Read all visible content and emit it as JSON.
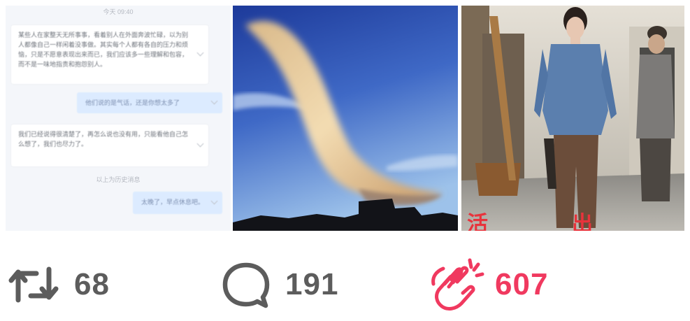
{
  "images": [
    {
      "label": "chat screenshot",
      "system_lines": [
        "今天 09:40",
        "以上为历史消息"
      ],
      "messages": [
        {
          "side": "in",
          "text": "某些人在家整天无所事事，看着别人在外面奔波忙碌，以为别人都像自己一样闲着没事做。其实每个人都有各自的压力和烦恼，只是不愿意表现出来而已，我们应该多一些理解和包容，而不是一味地指责和抱怨别人。"
        },
        {
          "side": "out",
          "text": "他们说的是气话，还是你想太多了"
        },
        {
          "side": "in",
          "text": "我们已经说得很清楚了，再怎么说也没有用，只能看他自己怎么想了，我们也尽力了。"
        },
        {
          "side": "out",
          "text": "太晚了，早点休息吧。"
        }
      ]
    },
    {
      "label": "cloud over sky at dusk"
    },
    {
      "label": "woman in blue jacket walking on old street",
      "caption": "活出 活出"
    }
  ],
  "actions": {
    "retweet": {
      "icon": "retweet-icon",
      "count": "68",
      "color": "#5c5c5c"
    },
    "comment": {
      "icon": "comment-icon",
      "count": "191",
      "color": "#5c5c5c"
    },
    "applaud": {
      "icon": "clap-icon",
      "count": "607",
      "color": "#f0395f"
    }
  }
}
